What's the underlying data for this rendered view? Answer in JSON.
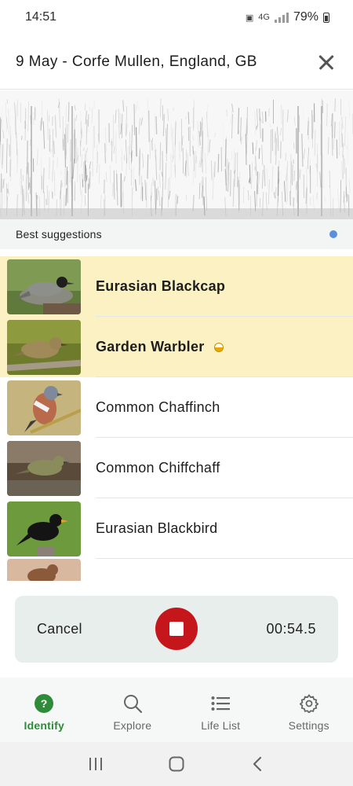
{
  "status_bar": {
    "time": "14:51",
    "network": "4G",
    "battery": "79%"
  },
  "header": {
    "title": "9 May - Corfe Mullen, England, GB",
    "close_icon": "close-icon"
  },
  "suggestions": {
    "label": "Best suggestions",
    "indicator_color": "#5b8fd9"
  },
  "species": [
    {
      "name": "Eurasian Blackcap",
      "highlighted": true
    },
    {
      "name": "Garden Warbler",
      "highlighted": true,
      "confidence_icon": "half-circle-icon"
    },
    {
      "name": "Common Chaffinch",
      "highlighted": false
    },
    {
      "name": "Common Chiffchaff",
      "highlighted": false
    },
    {
      "name": "Eurasian Blackbird",
      "highlighted": false
    }
  ],
  "recording": {
    "cancel_label": "Cancel",
    "timer": "00:54.5",
    "stop_icon": "stop-icon",
    "stop_color": "#c5161c"
  },
  "nav": {
    "items": [
      {
        "label": "Identify",
        "icon": "question-circle-icon",
        "active": true
      },
      {
        "label": "Explore",
        "icon": "search-icon",
        "active": false
      },
      {
        "label": "Life List",
        "icon": "list-icon",
        "active": false
      },
      {
        "label": "Settings",
        "icon": "gear-icon",
        "active": false
      }
    ],
    "active_color": "#2e8b3a"
  },
  "colors": {
    "highlight": "#fbf1c3",
    "record_bar": "#e8eeec"
  }
}
